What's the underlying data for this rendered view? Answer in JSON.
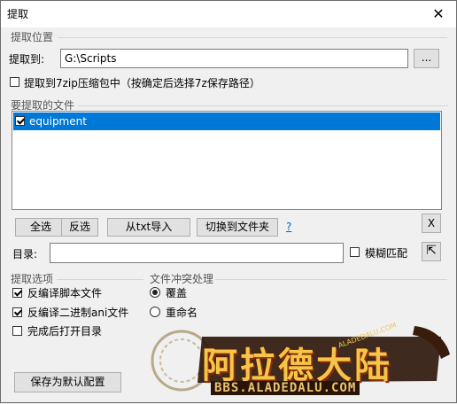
{
  "window": {
    "title": "提取",
    "close_glyph": "✕"
  },
  "location_group": {
    "label": "提取位置"
  },
  "extract_to": {
    "label": "提取到:",
    "value": "G:\\Scripts",
    "browse_label": "..."
  },
  "zip_option": {
    "label": "提取到7zip压缩包中（按确定后选择7z保存路径）",
    "checked": false
  },
  "files_group": {
    "label": "要提取的文件"
  },
  "file_list": {
    "items": [
      {
        "name": "equipment",
        "checked": true,
        "selected": true
      }
    ]
  },
  "buttons": {
    "select_all": "全选",
    "invert": "反选",
    "import_txt": "从txt导入",
    "switch_folder": "切换到文件夹",
    "help": "?",
    "clear": "X"
  },
  "directory": {
    "label": "目录:",
    "value": "",
    "fuzzy_label": "模糊匹配",
    "fuzzy_checked": false,
    "up_glyph": "⇱"
  },
  "options_group": {
    "label": "提取选项",
    "items": [
      {
        "label": "反编译脚本文件",
        "checked": true
      },
      {
        "label": "反编译二进制ani文件",
        "checked": true
      },
      {
        "label": "完成后打开目录",
        "checked": false
      }
    ]
  },
  "conflict_group": {
    "label": "文件冲突处理",
    "items": [
      {
        "label": "覆盖",
        "selected": true
      },
      {
        "label": "重命名",
        "selected": false
      }
    ]
  },
  "save_default": "保存为默认配置",
  "watermark": {
    "text": "阿拉德大陆",
    "url": "BBS.ALADEDALU.COM",
    "small": "ALADEDALU.COM"
  }
}
